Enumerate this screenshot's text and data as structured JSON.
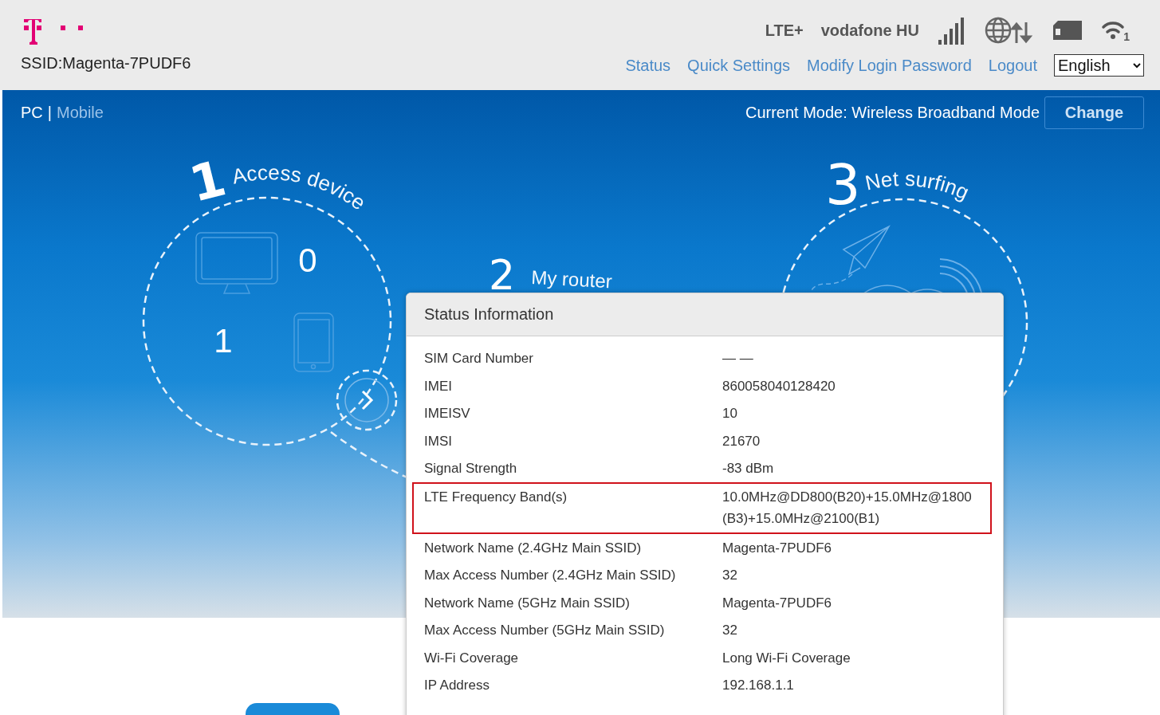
{
  "header": {
    "ssid": "SSID:Magenta-7PUDF6",
    "network_type": "LTE+",
    "operator": "vodafone HU",
    "wifi_clients": "1",
    "nav": [
      "Status",
      "Quick Settings",
      "Modify Login Password",
      "Logout"
    ],
    "language": "English"
  },
  "view_switch": {
    "items": [
      {
        "label": "PC",
        "selected": true
      },
      {
        "label": "Mobile",
        "selected": false
      }
    ],
    "separator": "|"
  },
  "mode": {
    "text": "Current Mode: Wireless Broadband Mode",
    "button": "Change"
  },
  "steps": [
    {
      "number": "1",
      "title": "Access device",
      "counts": [
        "0",
        "1"
      ]
    },
    {
      "number": "2",
      "title": "My router"
    },
    {
      "number": "3",
      "title": "Net surfing"
    }
  ],
  "dialog": {
    "title": "Status Information",
    "rows": [
      {
        "label": "SIM Card Number",
        "value": "— —",
        "highlighted": false
      },
      {
        "label": "IMEI",
        "value": "860058040128420",
        "highlighted": false
      },
      {
        "label": "IMEISV",
        "value": "10",
        "highlighted": false
      },
      {
        "label": "IMSI",
        "value": "21670",
        "highlighted": false
      },
      {
        "label": "Signal Strength",
        "value": "-83 dBm",
        "highlighted": false
      },
      {
        "label": "LTE Frequency Band(s)",
        "value": "10.0MHz@DD800(B20)+15.0MHz@1800(B3)+15.0MHz@2100(B1)",
        "highlighted": true
      },
      {
        "label": "Network Name (2.4GHz Main SSID)",
        "value": "Magenta-7PUDF6",
        "highlighted": false
      },
      {
        "label": "Max Access Number (2.4GHz Main SSID)",
        "value": "32",
        "highlighted": false
      },
      {
        "label": "Network Name (5GHz Main SSID)",
        "value": "Magenta-7PUDF6",
        "highlighted": false
      },
      {
        "label": "Max Access Number (5GHz Main SSID)",
        "value": "32",
        "highlighted": false
      },
      {
        "label": "Wi-Fi Coverage",
        "value": "Long Wi-Fi Coverage",
        "highlighted": false
      },
      {
        "label": "IP Address",
        "value": "192.168.1.1",
        "highlighted": false
      }
    ]
  }
}
